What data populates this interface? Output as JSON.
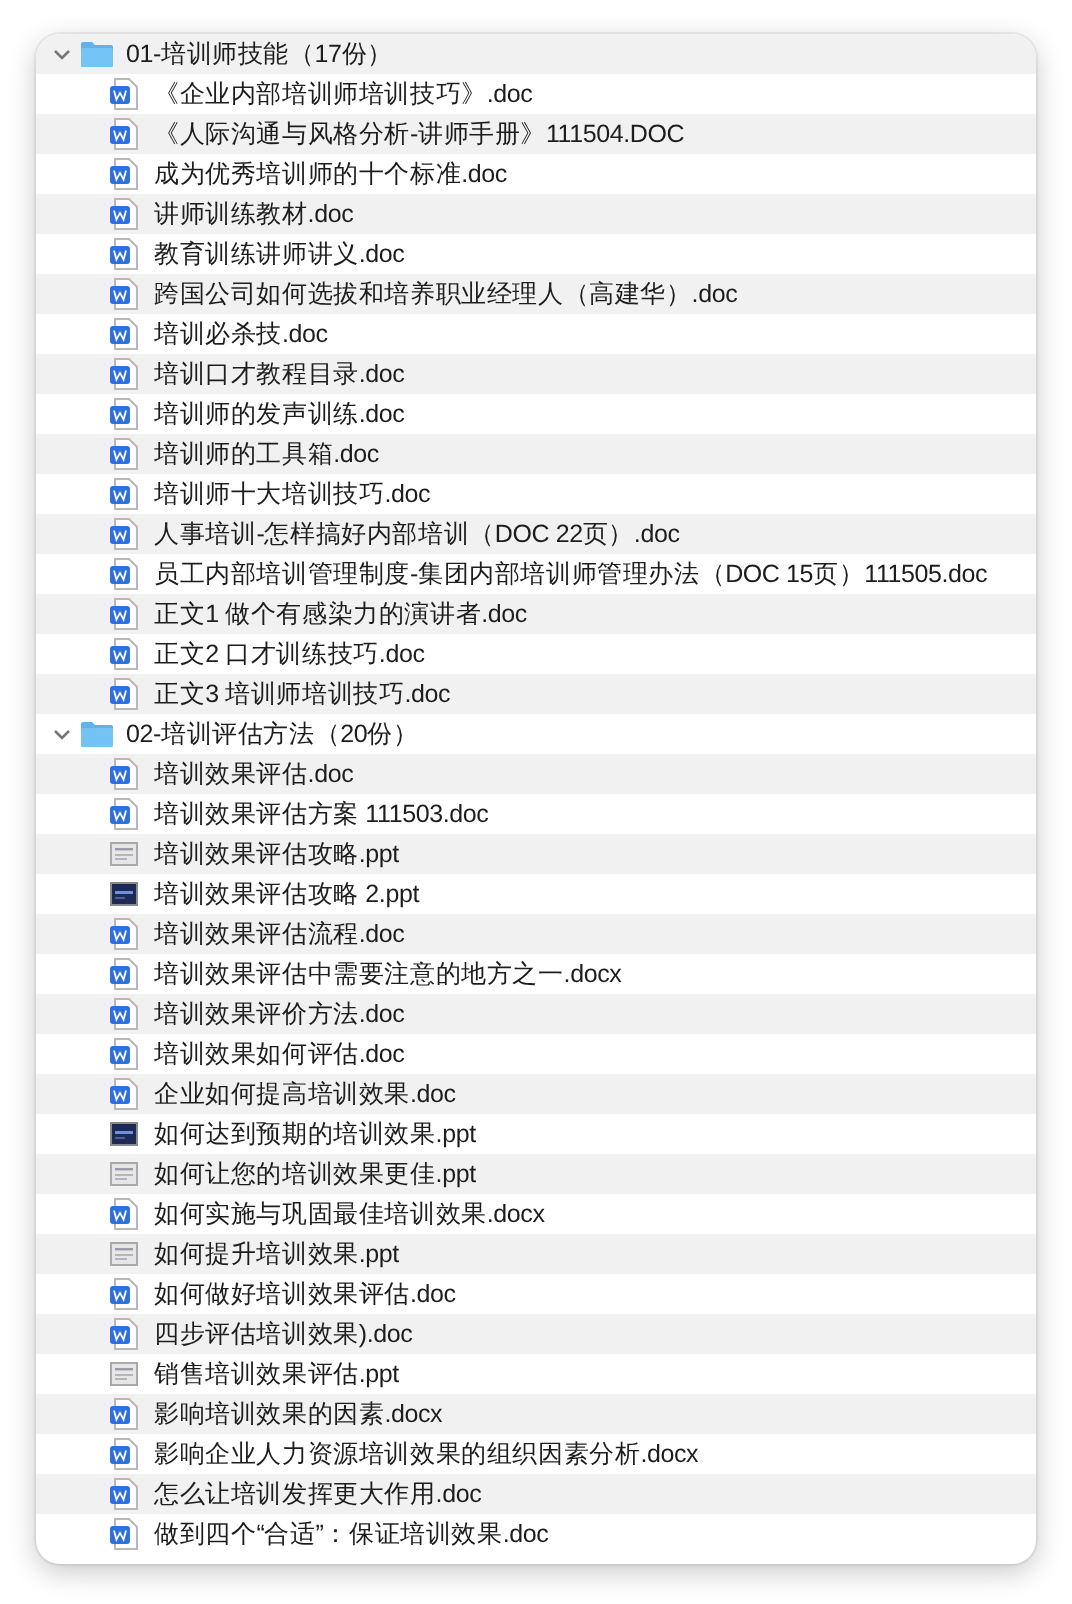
{
  "folders": [
    {
      "name": "01-培训师技能（17份）",
      "expanded": true,
      "files": [
        {
          "name": "《企业内部培训师培训技巧》.doc",
          "kind": "word"
        },
        {
          "name": "《人际沟通与风格分析-讲师手册》111504.DOC",
          "kind": "word"
        },
        {
          "name": "成为优秀培训师的十个标准.doc",
          "kind": "word"
        },
        {
          "name": "讲师训练教材.doc",
          "kind": "word"
        },
        {
          "name": "教育训练讲师讲义.doc",
          "kind": "word"
        },
        {
          "name": "跨国公司如何选拔和培养职业经理人（高建华）.doc",
          "kind": "word"
        },
        {
          "name": "培训必杀技.doc",
          "kind": "word"
        },
        {
          "name": "培训口才教程目录.doc",
          "kind": "word"
        },
        {
          "name": "培训师的发声训练.doc",
          "kind": "word"
        },
        {
          "name": "培训师的工具箱.doc",
          "kind": "word"
        },
        {
          "name": "培训师十大培训技巧.doc",
          "kind": "word"
        },
        {
          "name": "人事培训-怎样搞好内部培训（DOC 22页）.doc",
          "kind": "word"
        },
        {
          "name": "员工内部培训管理制度-集团内部培训师管理办法（DOC 15页）111505.doc",
          "kind": "word"
        },
        {
          "name": "正文1  做个有感染力的演讲者.doc",
          "kind": "word"
        },
        {
          "name": "正文2  口才训练技巧.doc",
          "kind": "word"
        },
        {
          "name": "正文3 培训师培训技巧.doc",
          "kind": "word"
        }
      ]
    },
    {
      "name": "02-培训评估方法（20份）",
      "expanded": true,
      "files": [
        {
          "name": "培训效果评估.doc",
          "kind": "word"
        },
        {
          "name": "培训效果评估方案 111503.doc",
          "kind": "word"
        },
        {
          "name": "培训效果评估攻略.ppt",
          "kind": "slides-light"
        },
        {
          "name": "培训效果评估攻略 2.ppt",
          "kind": "slides-dark"
        },
        {
          "name": "培训效果评估流程.doc",
          "kind": "word"
        },
        {
          "name": "培训效果评估中需要注意的地方之一.docx",
          "kind": "word"
        },
        {
          "name": "培训效果评价方法.doc",
          "kind": "word"
        },
        {
          "name": "培训效果如何评估.doc",
          "kind": "word"
        },
        {
          "name": "企业如何提高培训效果.doc",
          "kind": "word"
        },
        {
          "name": "如何达到预期的培训效果.ppt",
          "kind": "slides-dark"
        },
        {
          "name": "如何让您的培训效果更佳.ppt",
          "kind": "slides-light"
        },
        {
          "name": "如何实施与巩固最佳培训效果.docx",
          "kind": "word"
        },
        {
          "name": "如何提升培训效果.ppt",
          "kind": "slides-light"
        },
        {
          "name": "如何做好培训效果评估.doc",
          "kind": "word"
        },
        {
          "name": "四步评估培训效果).doc",
          "kind": "word"
        },
        {
          "name": "销售培训效果评估.ppt",
          "kind": "slides-light"
        },
        {
          "name": "影响培训效果的因素.docx",
          "kind": "word"
        },
        {
          "name": "影响企业人力资源培训效果的组织因素分析.docx",
          "kind": "word"
        },
        {
          "name": "怎么让培训发挥更大作用.doc",
          "kind": "word"
        },
        {
          "name": "做到四个“合适”：保证培训效果.doc",
          "kind": "word"
        }
      ]
    }
  ]
}
